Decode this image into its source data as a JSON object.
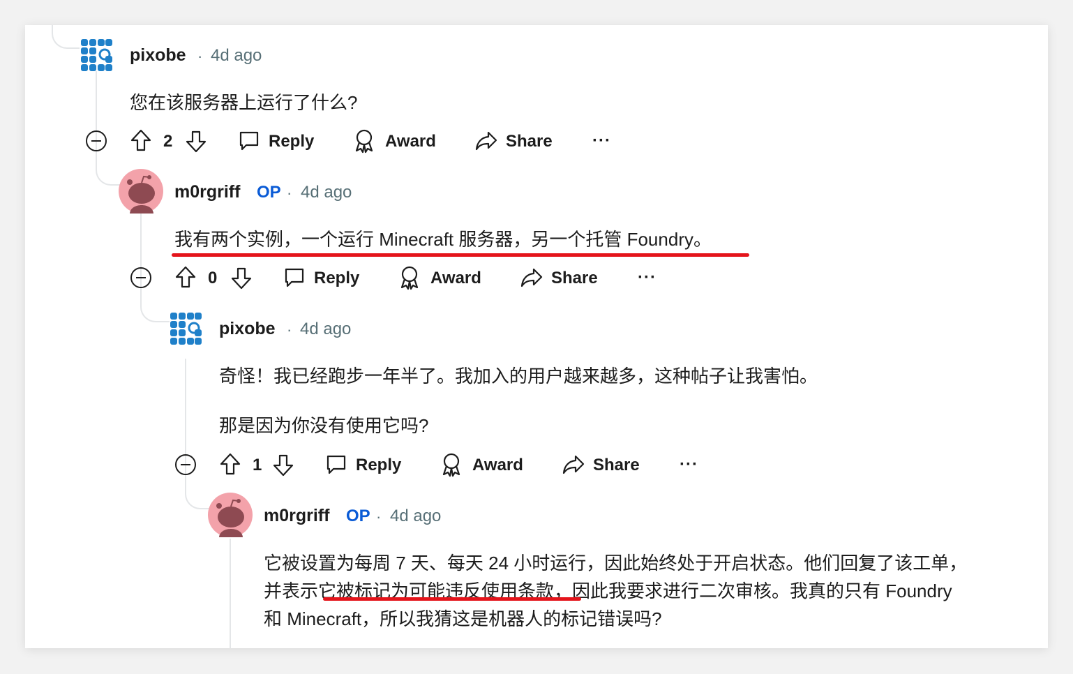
{
  "comments": [
    {
      "author": "pixobe",
      "sep": "·",
      "time": "4d ago",
      "body": [
        "您在该服务器上运行了什么?"
      ],
      "votes": "2",
      "actions": {
        "reply": "Reply",
        "award": "Award",
        "share": "Share",
        "more": "···"
      }
    },
    {
      "author": "m0rgriff",
      "op_badge": "OP",
      "sep": "·",
      "time": "4d ago",
      "body": [
        "我有两个实例，一个运行 Minecraft 服务器，另一个托管 Foundry。"
      ],
      "votes": "0",
      "actions": {
        "reply": "Reply",
        "award": "Award",
        "share": "Share",
        "more": "···"
      }
    },
    {
      "author": "pixobe",
      "sep": "·",
      "time": "4d ago",
      "body": [
        "奇怪！我已经跑步一年半了。我加入的用户越来越多，这种帖子让我害怕。",
        "那是因为你没有使用它吗?"
      ],
      "votes": "1",
      "actions": {
        "reply": "Reply",
        "award": "Award",
        "share": "Share",
        "more": "···"
      }
    },
    {
      "author": "m0rgriff",
      "op_badge": "OP",
      "sep": "·",
      "time": "4d ago",
      "body": [
        "它被设置为每周 7 天、每天 24 小时运行，因此始终处于开启状态。他们回复了该工单，",
        "并表示它被标记为可能违反使用条款，因此我要求进行二次审核。我真的只有 Foundry",
        "和 Minecraft，所以我猜这是机器人的标记错误吗?"
      ]
    }
  ],
  "colors": {
    "op_badge": "#0a5bd6",
    "highlight_underline": "#e4141b",
    "pixobe_avatar": "#1f80c9",
    "m0rgriff_avatar_bg": "#f3a2aa"
  },
  "icons": [
    "collapse-icon",
    "upvote-icon",
    "downvote-icon",
    "reply-icon",
    "award-icon",
    "share-icon",
    "more-icon",
    "avatar-icon"
  ]
}
